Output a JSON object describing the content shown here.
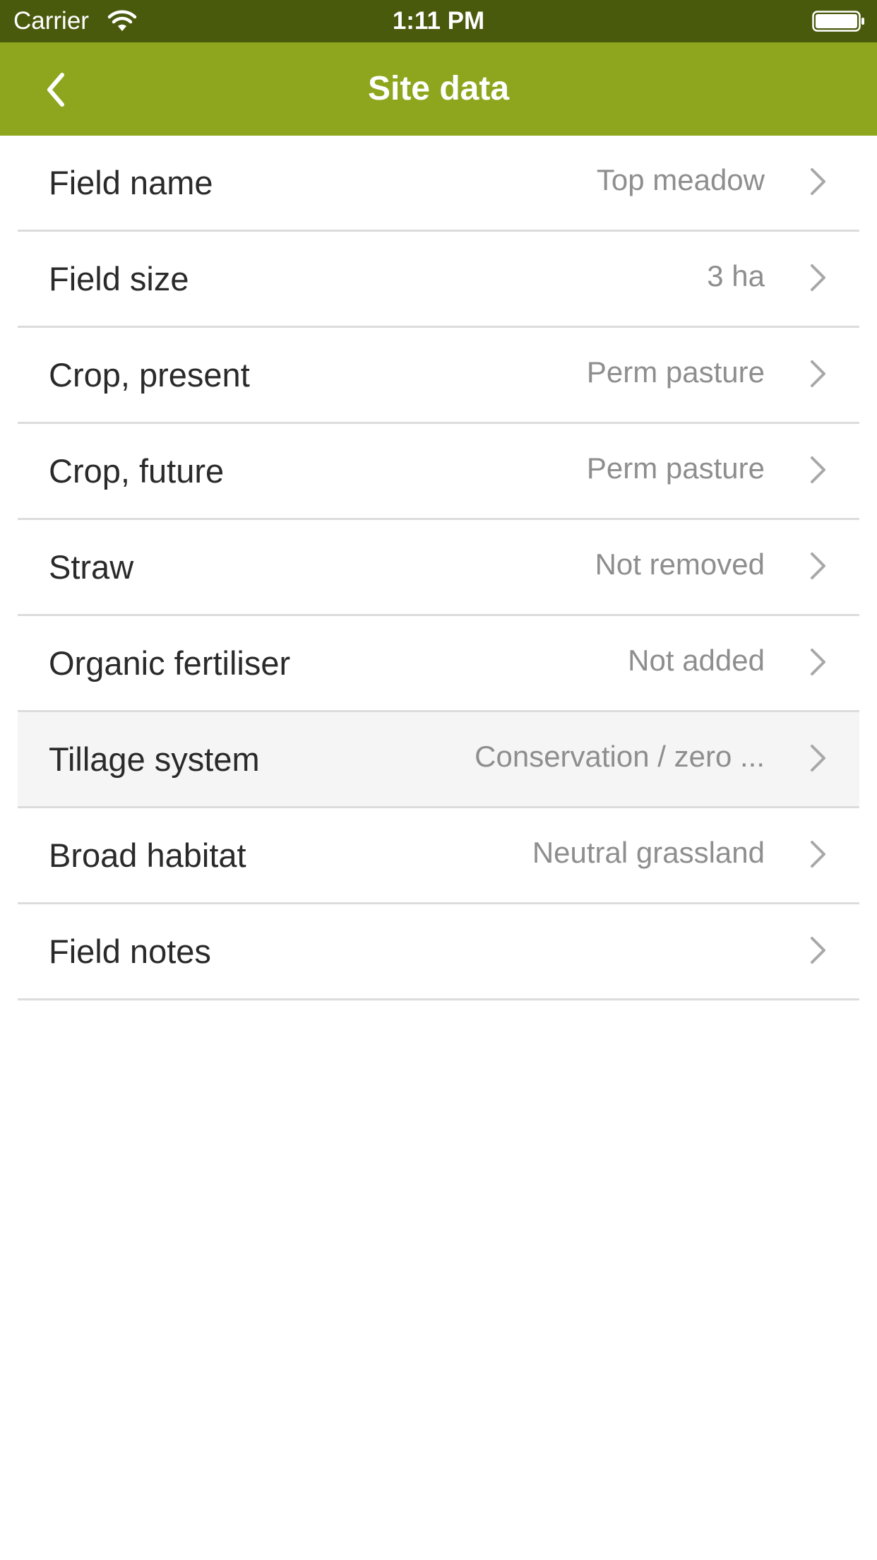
{
  "status_bar": {
    "carrier": "Carrier",
    "time": "1:11 PM",
    "icons": [
      "wifi-icon",
      "battery-icon"
    ]
  },
  "nav": {
    "title": "Site data",
    "back_icon": "chevron-left-icon"
  },
  "rows": [
    {
      "label": "Field name",
      "value": "Top meadow"
    },
    {
      "label": "Field size",
      "value": "3 ha"
    },
    {
      "label": "Crop, present",
      "value": "Perm pasture"
    },
    {
      "label": "Crop, future",
      "value": "Perm pasture"
    },
    {
      "label": "Straw",
      "value": "Not removed"
    },
    {
      "label": "Organic fertiliser",
      "value": "Not added"
    },
    {
      "label": "Tillage system",
      "value": "Conservation / zero ..."
    },
    {
      "label": "Broad habitat",
      "value": "Neutral grassland"
    },
    {
      "label": "Field notes",
      "value": ""
    }
  ],
  "colors": {
    "status_bar": "#4a5a0d",
    "nav_bar": "#8da61e",
    "highlighted_row": "#f5f5f5"
  }
}
